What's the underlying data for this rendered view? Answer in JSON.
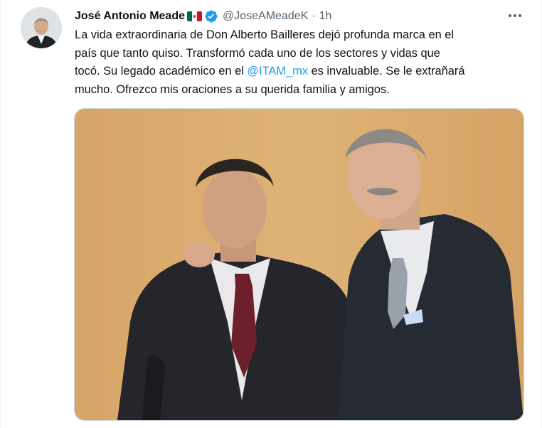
{
  "tweet": {
    "author": {
      "display_name": "José Antonio Meade",
      "handle": "@JoseAMeadeK",
      "avatar_icon": "profile-photo-icon",
      "verified_icon": "verified-badge-icon",
      "flag_icon": "mexico-flag-icon"
    },
    "separator": "·",
    "time": "1h",
    "more_icon": "more-options-icon",
    "text": {
      "line1": "La vida extraordinaria de Don Alberto Bailleres dejó profunda marca en el",
      "line2": "país que tanto quiso. Transformó cada uno de los sectores y vidas que",
      "line3_before": "tocó. Su legado académico en el ",
      "mention": "@ITAM_mx",
      "line3_after": " es invaluable. Se le extrañará",
      "line4": "mucho. Ofrezco mis oraciones a su querida familia y amigos."
    }
  },
  "colors": {
    "link": "#1d9bf0",
    "secondary_text": "#536471",
    "primary_text": "#0f1419",
    "border": "#cfd9de"
  }
}
